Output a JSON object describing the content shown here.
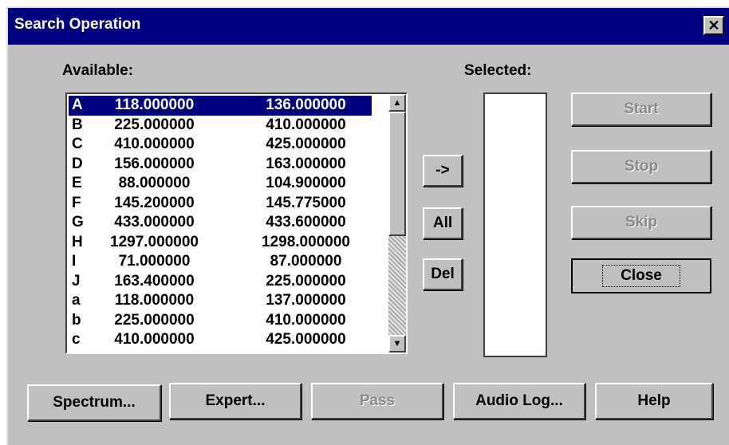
{
  "window": {
    "title": "Search Operation",
    "close_glyph": "✕"
  },
  "available": {
    "label": "Available:",
    "items": [
      {
        "letter": "A",
        "low": "118.000000",
        "high": "136.000000"
      },
      {
        "letter": "B",
        "low": "225.000000",
        "high": "410.000000"
      },
      {
        "letter": "C",
        "low": "410.000000",
        "high": "425.000000"
      },
      {
        "letter": "D",
        "low": "156.000000",
        "high": "163.000000"
      },
      {
        "letter": "E",
        "low": "88.000000",
        "high": "104.900000"
      },
      {
        "letter": "F",
        "low": "145.200000",
        "high": "145.775000"
      },
      {
        "letter": "G",
        "low": "433.000000",
        "high": "433.600000"
      },
      {
        "letter": "H",
        "low": "1297.000000",
        "high": "1298.000000"
      },
      {
        "letter": "I",
        "low": "71.000000",
        "high": "87.000000"
      },
      {
        "letter": "J",
        "low": "163.400000",
        "high": "225.000000"
      },
      {
        "letter": "a",
        "low": "118.000000",
        "high": "137.000000"
      },
      {
        "letter": "b",
        "low": "225.000000",
        "high": "410.000000"
      },
      {
        "letter": "c",
        "low": "410.000000",
        "high": "425.000000"
      }
    ],
    "selected_index": 0
  },
  "selected": {
    "label": "Selected:"
  },
  "transfer": {
    "add_label": "->",
    "all_label": "All",
    "del_label": "Del"
  },
  "actions": {
    "start_label": "Start",
    "stop_label": "Stop",
    "skip_label": "Skip",
    "close_label": "Close"
  },
  "bottom": {
    "spectrum_label": "Spectrum...",
    "expert_label": "Expert...",
    "pass_label": "Pass",
    "audio_log_label": "Audio Log...",
    "help_label": "Help"
  },
  "scroll": {
    "up_glyph": "▲",
    "down_glyph": "▼"
  },
  "colors": {
    "title_bar": "#000080",
    "selection": "#000080",
    "face": "#c0c0c0"
  }
}
